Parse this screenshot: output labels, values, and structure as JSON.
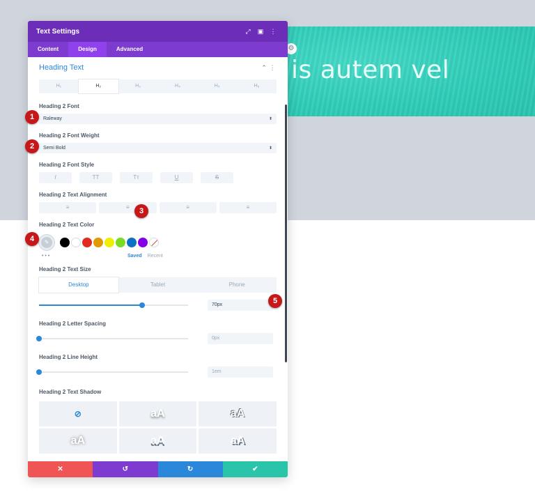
{
  "preview": {
    "heading_text": "is autem vel",
    "accent": "#2fcdb8"
  },
  "panel": {
    "title": "Text Settings",
    "header_icons": [
      "expand-icon",
      "sidebar-icon",
      "more-icon"
    ],
    "tabs": [
      "Content",
      "Design",
      "Advanced"
    ],
    "active_tab": "Design",
    "section_title": "Heading Text",
    "heading_tabs": [
      "H₁",
      "H₂",
      "H₃",
      "H₄",
      "H₅",
      "H₆"
    ],
    "heading_font": {
      "label": "Heading 2 Font",
      "value": "Raleway"
    },
    "heading_weight": {
      "label": "Heading 2 Font Weight",
      "value": "Semi Bold"
    },
    "font_style": {
      "label": "Heading 2 Font Style",
      "buttons": [
        "I",
        "TT",
        "Tт",
        "U",
        "S"
      ]
    },
    "alignment": {
      "label": "Heading 2 Text Alignment",
      "buttons": [
        "≡",
        "≡",
        "≡",
        "≡"
      ]
    },
    "text_color": {
      "label": "Heading 2 Text Color",
      "swatches": [
        "#000000",
        "#ffffff",
        "#e02b20",
        "#e09900",
        "#edf000",
        "#7cda24",
        "#0c71c3",
        "#8300e9"
      ],
      "more": "• • •",
      "saved": "Saved",
      "recent": "Recent"
    },
    "text_size": {
      "label": "Heading 2 Text Size",
      "devices": [
        "Desktop",
        "Tablet",
        "Phone"
      ],
      "value": "70px",
      "slider_fraction": 0.69
    },
    "letter_spacing": {
      "label": "Heading 2 Letter Spacing",
      "value": "0px",
      "slider_fraction": 0.0
    },
    "line_height": {
      "label": "Heading 2 Line Height",
      "value": "1em",
      "slider_fraction": 0.0
    },
    "text_shadow": {
      "label": "Heading 2 Text Shadow",
      "preview_text": "aA",
      "none_icon": "⊘"
    },
    "footer": {
      "cancel": "✕",
      "undo": "↺",
      "redo": "↻",
      "save": "✔"
    },
    "colors": {
      "header": "#6c2eb9",
      "tabs": "#7e3bd0",
      "link": "#2b87da",
      "cancel": "#ef5555",
      "save": "#29c4a9"
    }
  },
  "markers": [
    "1",
    "2",
    "3",
    "4",
    "5"
  ]
}
